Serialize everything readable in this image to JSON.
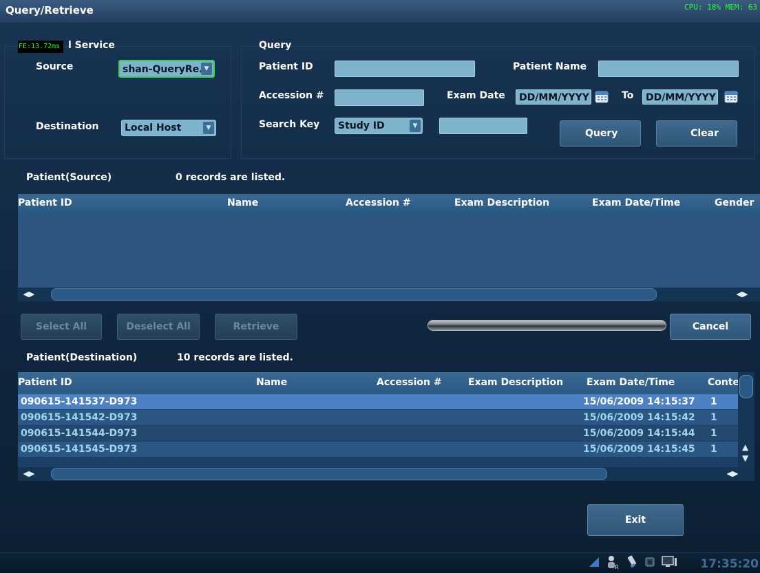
{
  "title": "Query/Retrieve",
  "status_overlay": "CPU: 18%  MEM: 63",
  "fps_overlay": "FE:13.72ms",
  "service_group": {
    "legend": "l Service",
    "source_label": "Source",
    "source_value": "shan-QueryRe..",
    "destination_label": "Destination",
    "destination_value": "Local Host"
  },
  "query_group": {
    "legend": "Query",
    "patient_id_label": "Patient ID",
    "patient_id_value": "",
    "patient_name_label": "Patient Name",
    "patient_name_value": "",
    "accession_label": "Accession #",
    "accession_value": "",
    "exam_date_label": "Exam Date",
    "date_from": "DD/MM/YYYY",
    "to_label": "To",
    "date_to": "DD/MM/YYYY",
    "search_key_label": "Search Key",
    "search_key_value": "Study ID",
    "search_value": "",
    "query_button": "Query",
    "clear_button": "Clear"
  },
  "source_section": {
    "title": "Patient(Source)",
    "count": "0 records are listed.",
    "columns": [
      "Patient ID",
      "Name",
      "Accession #",
      "Exam Description",
      "Exam Date/Time",
      "Gender"
    ],
    "rows": []
  },
  "actions": {
    "select_all": "Select All",
    "deselect_all": "Deselect All",
    "retrieve": "Retrieve",
    "cancel": "Cancel",
    "progress": 0
  },
  "destination_section": {
    "title": "Patient(Destination)",
    "count": "10 records are listed.",
    "columns": [
      "Patient ID",
      "Name",
      "Accession #",
      "Exam Description",
      "Exam Date/Time",
      "Conte"
    ],
    "rows": [
      {
        "patient_id": "090615-141537-D973",
        "name": "",
        "accession": "",
        "description": "",
        "datetime": "15/06/2009 14:15:37",
        "content": "1",
        "selected": true
      },
      {
        "patient_id": "090615-141542-D973",
        "name": "",
        "accession": "",
        "description": "",
        "datetime": "15/06/2009 14:15:42",
        "content": "1",
        "selected": false
      },
      {
        "patient_id": "090615-141544-D973",
        "name": "",
        "accession": "",
        "description": "",
        "datetime": "15/06/2009 14:15:44",
        "content": "1",
        "selected": false
      },
      {
        "patient_id": "090615-141545-D973",
        "name": "",
        "accession": "",
        "description": "",
        "datetime": "15/06/2009 14:15:45",
        "content": "1",
        "selected": false
      }
    ]
  },
  "exit_button": "Exit",
  "clock": "17:35:20",
  "icons": [
    "flag-icon",
    "user-icon",
    "usb-icon",
    "printer-icon",
    "monitor-icon"
  ],
  "colors": {
    "accent": "#3f6a8e",
    "selected_row": "#4c82c4",
    "highlight_text": "#9fd4ec",
    "overlay_green": "#22ff22"
  }
}
